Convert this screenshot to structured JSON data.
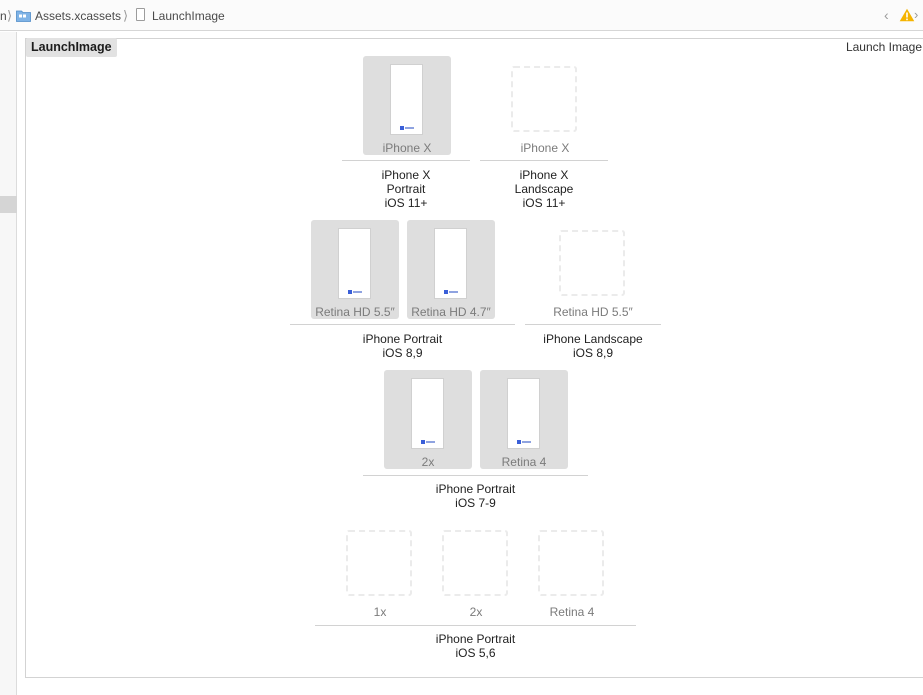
{
  "jumpbar": {
    "truncated_crumb": "n",
    "folder": "Assets.xcassets",
    "asset": "LaunchImage",
    "icons": [
      "chevron-left-icon",
      "warning-icon",
      "chevron-right-icon"
    ],
    "warning_color": "#f5b400"
  },
  "canvas": {
    "set_name": "LaunchImage",
    "set_type": "Launch Image"
  },
  "groups": {
    "iphonex_portrait": {
      "slots": [
        {
          "label": "iPhone X",
          "filled": true
        }
      ],
      "lines": [
        "iPhone X",
        "Portrait",
        "iOS 11+"
      ]
    },
    "iphonex_landscape": {
      "slots": [
        {
          "label": "iPhone X",
          "filled": false
        }
      ],
      "lines": [
        "iPhone X",
        "Landscape",
        "iOS 11+"
      ]
    },
    "iphone_portrait_8_9": {
      "slots": [
        {
          "label": "Retina HD 5.5″",
          "filled": true
        },
        {
          "label": "Retina HD 4.7″",
          "filled": true
        }
      ],
      "lines": [
        "iPhone Portrait",
        "iOS 8,9"
      ]
    },
    "iphone_landscape_8_9": {
      "slots": [
        {
          "label": "Retina HD 5.5″",
          "filled": false
        }
      ],
      "lines": [
        "iPhone Landscape",
        "iOS 8,9"
      ]
    },
    "iphone_portrait_7_9": {
      "slots": [
        {
          "label": "2x",
          "filled": true
        },
        {
          "label": "Retina 4",
          "filled": true
        }
      ],
      "lines": [
        "iPhone Portrait",
        "iOS 7-9"
      ]
    },
    "iphone_portrait_5_6": {
      "slots": [
        {
          "label": "1x",
          "filled": false
        },
        {
          "label": "2x",
          "filled": false
        },
        {
          "label": "Retina 4",
          "filled": false
        }
      ],
      "lines": [
        "iPhone Portrait",
        "iOS 5,6"
      ]
    }
  }
}
